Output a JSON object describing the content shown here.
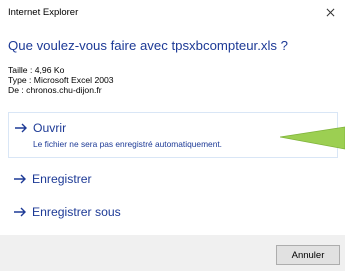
{
  "window": {
    "title": "Internet Explorer"
  },
  "dialog": {
    "question": "Que voulez-vous faire avec tpsxbcompteur.xls ?",
    "info": [
      "Taille : 4,96 Ko",
      "Type : Microsoft Excel 2003",
      "De : chronos.chu-dijon.fr"
    ],
    "options": {
      "open": {
        "label": "Ouvrir",
        "description": "Le fichier ne sera pas enregistré automatiquement."
      },
      "save": {
        "label": "Enregistrer"
      },
      "save_as": {
        "label": "Enregistrer sous"
      }
    },
    "cancel_label": "Annuler"
  },
  "colors": {
    "link_blue": "#1d3a96",
    "footer_bg": "#f0f0f0",
    "pointer_green": "#9ccf52"
  },
  "icons": {
    "close": "close-icon",
    "arrow": "arrow-right-icon"
  }
}
